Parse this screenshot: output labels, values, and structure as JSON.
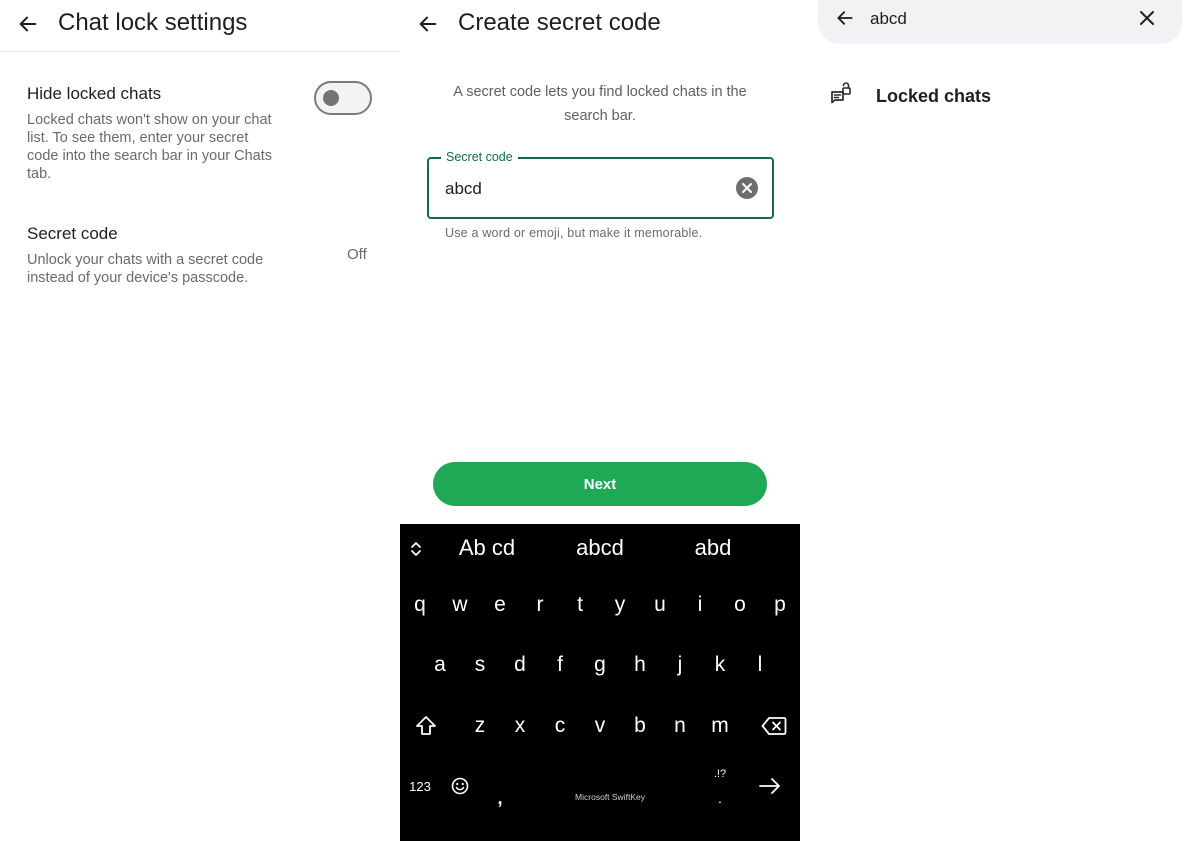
{
  "settings_screen": {
    "title": "Chat lock settings",
    "hide_locked": {
      "title": "Hide locked chats",
      "description": "Locked chats won't show on your chat list. To see them, enter your secret code into the search bar in your Chats tab.",
      "enabled": false
    },
    "secret_code": {
      "title": "Secret code",
      "description": "Unlock your chats with a secret code instead of your device's passcode.",
      "value": "Off"
    }
  },
  "create_code_screen": {
    "title": "Create secret code",
    "intro": "A secret code lets you find locked chats in the search bar.",
    "field": {
      "label": "Secret code",
      "value": "abcd"
    },
    "helper": "Use a word or emoji, but make it memorable.",
    "next_label": "Next"
  },
  "keyboard": {
    "suggestions": [
      "Ab cd",
      "abcd",
      "abd"
    ],
    "row1": [
      "q",
      "w",
      "e",
      "r",
      "t",
      "y",
      "u",
      "i",
      "o",
      "p"
    ],
    "row2": [
      "a",
      "s",
      "d",
      "f",
      "g",
      "h",
      "j",
      "k",
      "l"
    ],
    "row3": [
      "z",
      "x",
      "c",
      "v",
      "b",
      "n",
      "m"
    ],
    "numbers_label": "123",
    "comma": ",",
    "punct_hint": ".!?",
    "period": ".",
    "brand": "Microsoft SwiftKey",
    "icons": [
      "expand-icon",
      "shift-icon",
      "backspace-icon",
      "emoji-icon",
      "enter-arrow-icon"
    ]
  },
  "search_screen": {
    "query": "abcd",
    "result_label": "Locked chats",
    "icons": [
      "back-arrow-icon",
      "close-icon",
      "unlocked-chat-icon"
    ]
  },
  "colors": {
    "accent_green": "#1fa855",
    "field_border": "#12695a",
    "keyboard_bg": "#000000"
  }
}
